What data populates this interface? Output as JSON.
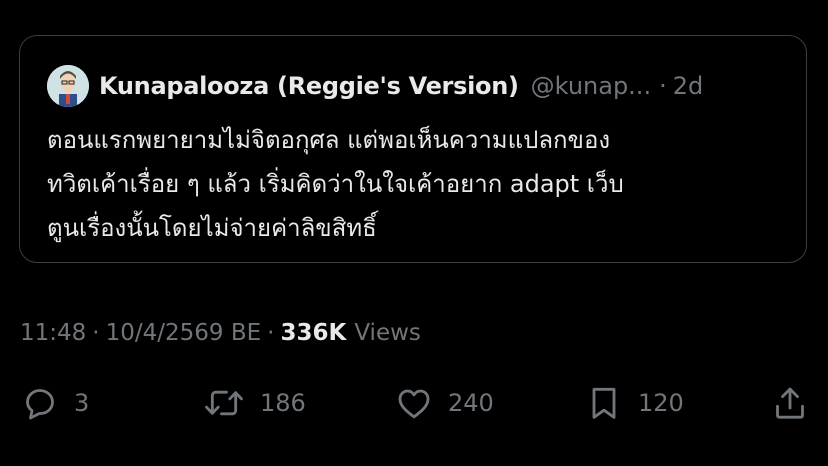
{
  "quoted_tweet": {
    "display_name": "Kunapalooza (Reggie's Version)",
    "handle": "@kunap...",
    "separator": "·",
    "time_ago": "2d",
    "text_lines": [
      "ตอนแรกพยายามไม่จิตอกุศล แต่พอเห็นความแปลกของ",
      "ทวิตเค้าเรื่อย ๆ แล้ว เริ่มคิดว่าในใจเค้าอยาก adapt เว็บ",
      "ตูนเรื่องนั้นโดยไม่จ่ายค่าลิขสิทธิ์"
    ]
  },
  "meta": {
    "time": "11:48",
    "separator": "·",
    "date": "10/4/2569 BE",
    "views_count": "336K",
    "views_label": "Views"
  },
  "actions": {
    "reply": {
      "icon": "reply-icon",
      "count": "3"
    },
    "repost": {
      "icon": "repost-icon",
      "count": "186"
    },
    "like": {
      "icon": "heart-icon",
      "count": "240"
    },
    "bookmark": {
      "icon": "bookmark-icon",
      "count": "120"
    },
    "share": {
      "icon": "share-icon"
    }
  },
  "colors": {
    "background": "#000000",
    "text_primary": "#e7e9ea",
    "text_secondary": "#71767b",
    "border": "#3a3d41"
  }
}
